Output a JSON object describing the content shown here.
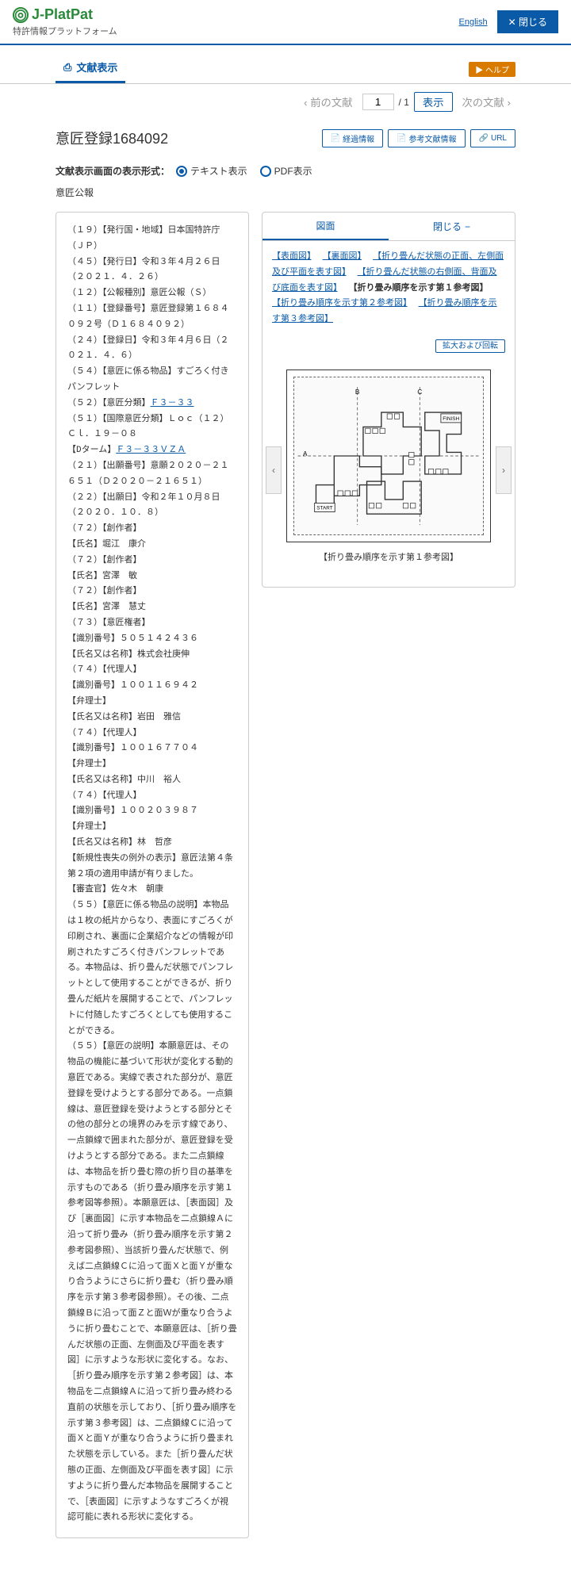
{
  "header": {
    "logo_text": "J-PlatPat",
    "logo_sub": "特許情報プラットフォーム",
    "english": "English",
    "close": "閉じる"
  },
  "tab": {
    "label": "文献表示"
  },
  "help": "ヘルプ",
  "nav": {
    "prev": "前の文献",
    "page": "1",
    "total": "/ 1",
    "show": "表示",
    "next": "次の文献"
  },
  "title": "意匠登録1684092",
  "actions": {
    "history": "経過情報",
    "ref": "参考文献情報",
    "url": "URL"
  },
  "format": {
    "label": "文献表示画面の表示形式：",
    "text": "テキスト表示",
    "pdf": "PDF表示"
  },
  "sub_label": "意匠公報",
  "biblio": {
    "l1": "（１９）【発行国・地域】日本国特許庁（ＪＰ）",
    "l2": "（４５）【発行日】令和３年４月２６日（２０２１．４．２６）",
    "l3": "（１２）【公報種別】意匠公報（Ｓ）",
    "l4": "（１１）【登録番号】意匠登録第１６８４０９２号（Ｄ１６８４０９２）",
    "l5": "（２４）【登録日】令和３年４月６日（２０２１．４．６）",
    "l6": "（５４）【意匠に係る物品】すごろく付きパンフレット",
    "l7a": "（５２）【意匠分類】",
    "l7b": "Ｆ３－３３",
    "l8": "（５１）【国際意匠分類】Ｌｏｃ（１２）Ｃｌ．１９－０８",
    "l9a": "【Dターム】",
    "l9b": "Ｆ３－３３ＶＺＡ",
    "l10": "（２１）【出願番号】意願２０２０－２１６５１（Ｄ２０２０－２１６５１）",
    "l11": "（２２）【出願日】令和２年１０月８日（２０２０．１０．８）",
    "l12": "（７２）【創作者】",
    "l13": "【氏名】堀江　康介",
    "l14": "（７２）【創作者】",
    "l15": "【氏名】宮澤　敏",
    "l16": "（７２）【創作者】",
    "l17": "【氏名】宮澤　慧丈",
    "l18": "（７３）【意匠権者】",
    "l19": "【識別番号】５０５１４２４３６",
    "l20": "【氏名又は名称】株式会社庚伸",
    "l21": "（７４）【代理人】",
    "l22": "【識別番号】１００１１６９４２",
    "l23": "【弁理士】",
    "l24": "【氏名又は名称】岩田　雅信",
    "l25": "（７４）【代理人】",
    "l26": "【識別番号】１００１６７７０４",
    "l27": "【弁理士】",
    "l28": "【氏名又は名称】中川　裕人",
    "l29": "（７４）【代理人】",
    "l30": "【識別番号】１００２０３９８７",
    "l31": "【弁理士】",
    "l32": "【氏名又は名称】林　哲彦",
    "l33": "【新規性喪失の例外の表示】意匠法第４条第２項の適用申請が有りました。",
    "l34": "【審査官】佐々木　朝康",
    "l35": "（５５）【意匠に係る物品の説明】本物品は１枚の紙片からなり、表面にすごろくが印刷され、裏面に企業紹介などの情報が印刷されたすごろく付きパンフレットである。本物品は、折り畳んだ状態でパンフレットとして使用することができるが、折り畳んだ紙片を展開することで、パンフレットに付随したすごろくとしても使用することができる。",
    "l36": "（５５）【意匠の説明】本願意匠は、その物品の機能に基づいて形状が変化する動的意匠である。実線で表された部分が、意匠登録を受けようとする部分である。一点鎖線は、意匠登録を受けようとする部分とその他の部分との境界のみを示す線であり、一点鎖線で囲まれた部分が、意匠登録を受けようとする部分である。また二点鎖線は、本物品を折り畳む際の折り目の基準を示すものである（折り畳み順序を示す第１参考図等参照）。本願意匠は、［表面図］及び［裏面図］に示す本物品を二点鎖線Ａに沿って折り畳み（折り畳み順序を示す第２参考図参照）、当該折り畳んだ状態で、例えば二点鎖線Ｃに沿って面Ｘと面Ｙが重なり合うようにさらに折り畳む（折り畳み順序を示す第３参考図参照）。その後、二点鎖線Ｂに沿って面Ｚと面Ｗが重なり合うように折り畳むことで、本願意匠は、［折り畳んだ状態の正面、左側面及び平面を表す図］に示すような形状に変化する。なお、［折り畳み順序を示す第２参考図］は、本物品を二点鎖線Ａに沿って折り畳み終わる直前の状態を示しており、［折り畳み順序を示す第３参考図］は、二点鎖線Ｃに沿って面Ｘと面Ｙが重なり合うように折り畳まれた状態を示している。また［折り畳んだ状態の正面、左側面及び平面を表す図］に示すように折り畳んだ本物品を展開することで、［表面図］に示すようなすごろくが視認可能に表れる形状に変化する。"
  },
  "image_panel": {
    "tab_fig": "図面",
    "tab_close": "閉じる",
    "links": {
      "f1": "【表面図】",
      "f2": "【裏面図】",
      "f3": "【折り畳んだ状態の正面、左側面及び平面を表す図】",
      "f4": "【折り畳んだ状態の右側面、背面及び底面を表す図】",
      "f5_label": "【折り畳み順序を示す第１参考図】",
      "f6": "【折り畳み順序を示す第２参考図】",
      "f7": "【折り畳み順序を示す第３参考図】"
    },
    "zoom": "拡大および回転",
    "caption": "【折り畳み順序を示す第１参考図】",
    "labels": {
      "a": "A",
      "b": "B",
      "c": "C",
      "start": "START",
      "finish": "FINISH"
    }
  }
}
